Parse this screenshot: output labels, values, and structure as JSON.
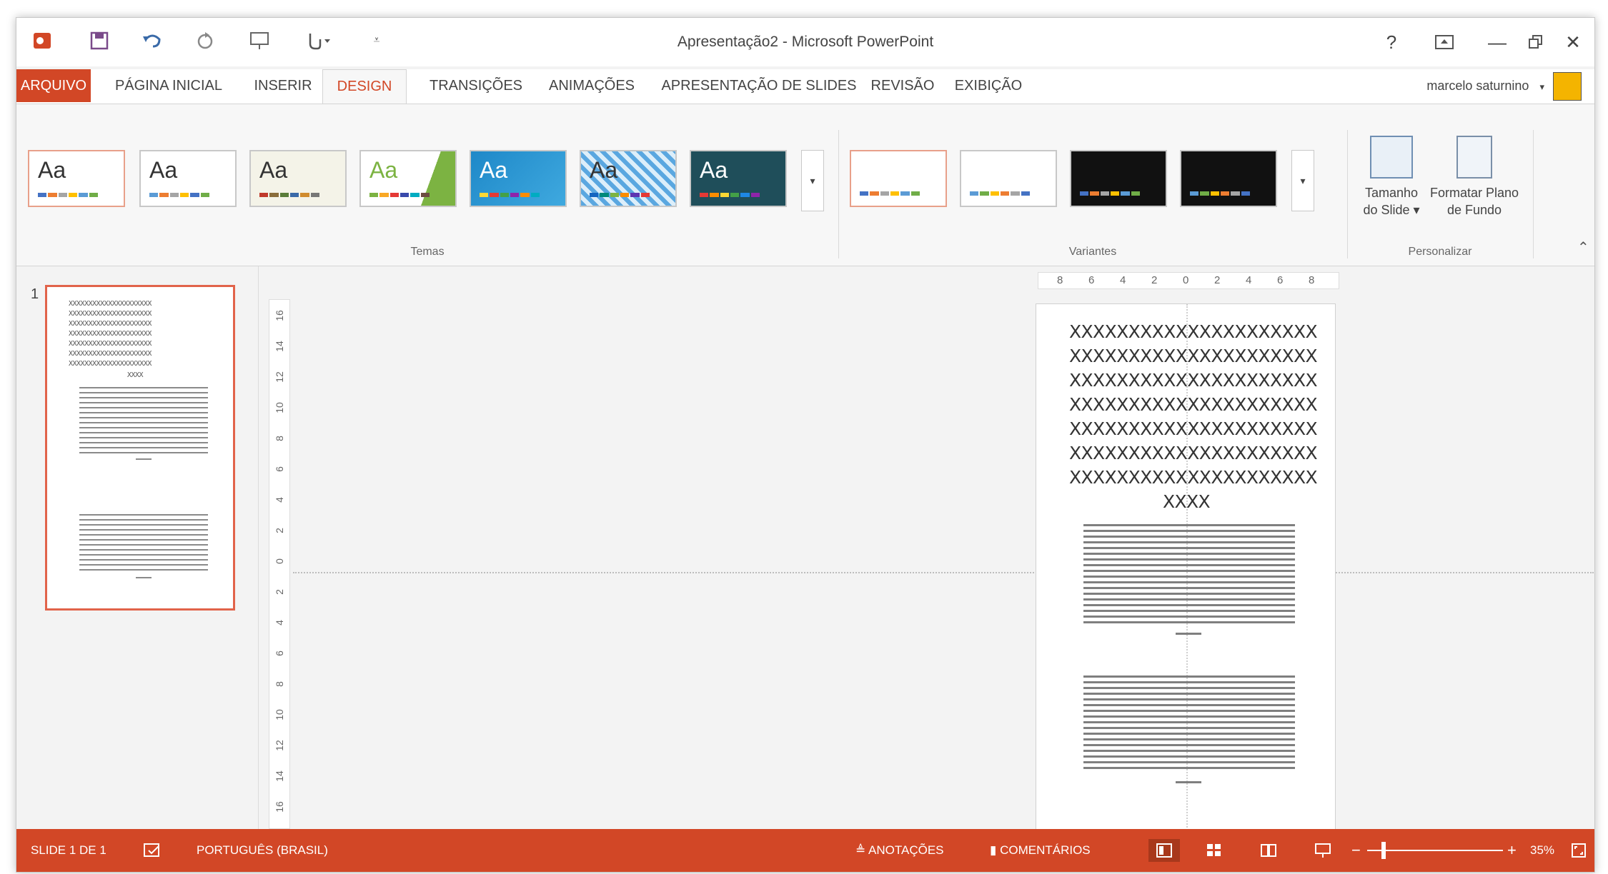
{
  "window": {
    "title": "Apresentação2 - Microsoft PowerPoint"
  },
  "qat": {
    "icons": [
      "powerpoint-logo-icon",
      "save-icon",
      "undo-icon",
      "redo-icon",
      "start-from-beginning-icon",
      "touch-mode-icon",
      "customize-qat-icon"
    ]
  },
  "window_controls": {
    "help": "?",
    "ribbon_display": "⧉",
    "minimize": "—",
    "restore": "🗗",
    "close": "✕"
  },
  "tabs": [
    {
      "label": "ARQUIVO"
    },
    {
      "label": "PÁGINA INICIAL"
    },
    {
      "label": "INSERIR"
    },
    {
      "label": "DESIGN"
    },
    {
      "label": "TRANSIÇÕES"
    },
    {
      "label": "ANIMAÇÕES"
    },
    {
      "label": "APRESENTAÇÃO DE SLIDES"
    },
    {
      "label": "REVISÃO"
    },
    {
      "label": "EXIBIÇÃO"
    }
  ],
  "active_tab": "DESIGN",
  "account": {
    "user_name": "marcelo saturnino",
    "caret": "▾"
  },
  "ribbon": {
    "themes_label": "Temas",
    "variants_label": "Variantes",
    "customize_label": "Personalizar",
    "theme_sample": "Aa",
    "slide_size_label": [
      "Tamanho",
      "do Slide ▾"
    ],
    "format_background_label": [
      "Formatar Plano",
      "de Fundo"
    ],
    "more_glyph": "▾",
    "collapse_glyph": "⌃"
  },
  "slides_pane": {
    "slide_number": "1",
    "title_line": "XXXXXXXXXXXXXXXXXXXXX",
    "title_short": "XXXX"
  },
  "slide": {
    "title_lines": [
      "XXXXXXXXXXXXXXXXXXXXX",
      "XXXXXXXXXXXXXXXXXXXXX",
      "XXXXXXXXXXXXXXXXXXXXX",
      "XXXXXXXXXXXXXXXXXXXXX",
      "XXXXXXXXXXXXXXXXXXXXX",
      "XXXXXXXXXXXXXXXXXXXXX",
      "XXXXXXXXXXXXXXXXXXXXX"
    ],
    "title_short": "XXXX"
  },
  "rulers": {
    "horizontal": [
      "8",
      "6",
      "4",
      "2",
      "0",
      "2",
      "4",
      "6",
      "8"
    ],
    "vertical": [
      "16",
      "14",
      "12",
      "10",
      "8",
      "6",
      "4",
      "2",
      "0",
      "2",
      "4",
      "6",
      "8",
      "10",
      "12",
      "14",
      "16"
    ]
  },
  "statusbar": {
    "slide_indicator": "SLIDE 1 DE 1",
    "language": "PORTUGUÊS (BRASIL)",
    "notes": "ANOTAÇÕES",
    "comments": "COMENTÁRIOS",
    "zoom_level": "35%",
    "zoom_minus": "−",
    "zoom_plus": "+"
  },
  "colors": {
    "accent": "#d24726",
    "selection": "#e1634a"
  }
}
